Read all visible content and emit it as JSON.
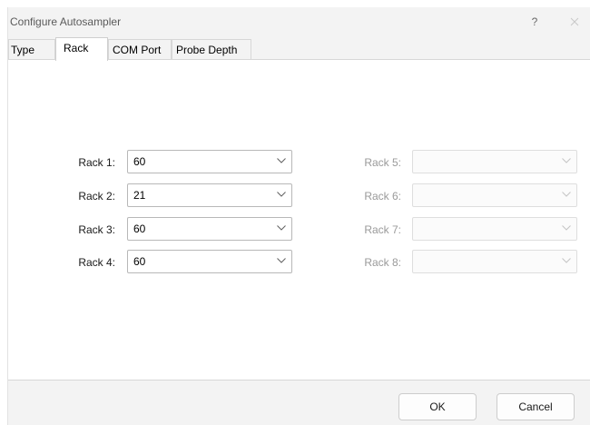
{
  "window": {
    "title": "Configure Autosampler",
    "help_label": "?"
  },
  "tabs": [
    {
      "label": "Type",
      "active": false
    },
    {
      "label": "Rack",
      "active": true
    },
    {
      "label": "COM Port",
      "active": false
    },
    {
      "label": "Probe Depth",
      "active": false
    }
  ],
  "racks_enabled": [
    {
      "label": "Rack 1:",
      "value": "60"
    },
    {
      "label": "Rack 2:",
      "value": "21"
    },
    {
      "label": "Rack 3:",
      "value": "60"
    },
    {
      "label": "Rack 4:",
      "value": "60"
    }
  ],
  "racks_disabled": [
    {
      "label": "Rack 5:",
      "value": ""
    },
    {
      "label": "Rack 6:",
      "value": ""
    },
    {
      "label": "Rack 7:",
      "value": ""
    },
    {
      "label": "Rack 8:",
      "value": ""
    }
  ],
  "buttons": {
    "ok": "OK",
    "cancel": "Cancel"
  },
  "colors": {
    "window_bg": "#f3f3f3",
    "page_bg": "#ffffff",
    "disabled_text": "#9a9a9a"
  },
  "icons": {
    "close": "close-icon",
    "dropdown": "chevron-down-icon"
  }
}
